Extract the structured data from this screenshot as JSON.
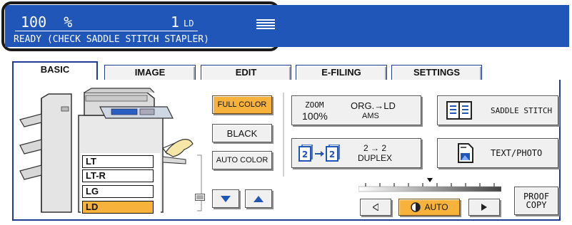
{
  "status": {
    "zoom": "100",
    "zoom_unit": "%",
    "quantity": "1",
    "paper": "LD",
    "message": "READY (CHECK SADDLE STITCH STAPLER)"
  },
  "tabs": [
    {
      "label": "BASIC",
      "active": true
    },
    {
      "label": "IMAGE",
      "active": false
    },
    {
      "label": "EDIT",
      "active": false
    },
    {
      "label": "E-FILING",
      "active": false
    },
    {
      "label": "SETTINGS",
      "active": false
    }
  ],
  "trays": [
    {
      "label": "LT",
      "selected": false
    },
    {
      "label": "LT-R",
      "selected": false
    },
    {
      "label": "LG",
      "selected": false
    },
    {
      "label": "LD",
      "selected": true
    }
  ],
  "color_modes": {
    "full_color": "FULL COLOR",
    "black": "BLACK",
    "auto_color": "AUTO COLOR",
    "selected": "full_color"
  },
  "zoom_button": {
    "label": "ZOOM",
    "value": "100%",
    "org_label": "ORG.",
    "arrow": "→",
    "target_paper": "LD",
    "mode": "AMS"
  },
  "duplex_button": {
    "mode": "2 → 2",
    "label": "DUPLEX"
  },
  "saddle_stitch_button": {
    "label": "SADDLE STITCH"
  },
  "text_photo_button": {
    "label": "TEXT/PHOTO"
  },
  "density": {
    "auto_label": "AUTO",
    "level_fraction": 0.5
  },
  "proof_copy_button": {
    "line1": "PROOF",
    "line2": "COPY"
  },
  "icons": [
    "stack-icon",
    "tray-list-icon",
    "arrow-down-icon",
    "arrow-up-icon",
    "duplex-icon",
    "book-icon",
    "text-photo-icon",
    "lighter-arrow-icon",
    "darker-arrow-icon",
    "auto-density-icon"
  ],
  "colors": {
    "status_blue": "#1f56b8",
    "tab_border": "#1e3c96",
    "selected_orange": "#f7b23b"
  }
}
